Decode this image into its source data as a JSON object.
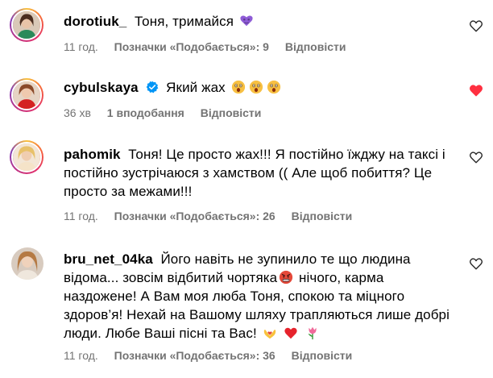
{
  "comments": [
    {
      "username": "dorotiuk_",
      "text": "Тоня, тримайся",
      "time": "11 год.",
      "likes": "Позначки «Подобається»: 9",
      "reply": "Відповісти"
    },
    {
      "username": "cybulskaya",
      "text": "Який жах",
      "time": "36 хв",
      "likes": "1 вподобання",
      "reply": "Відповісти"
    },
    {
      "username": "pahomik",
      "text": "Тоня! Це просто жах!!! Я постійно їжджу на таксі і постійно зустрічаюся з хамством (( Але щоб побиття? Це просто за межами!!!",
      "time": "11 год.",
      "likes": "Позначки «Подобається»: 26",
      "reply": "Відповісти"
    },
    {
      "username": "bru_net_04ka",
      "text_part1": "Його навіть не зупинило те що людина відома... зовсім відбитий чортяка",
      "text_part2": "нічого, карма наздожене! А Вам моя люба Тоня, спокою та міцного здоров’я! Нехай на Вашому шляху трапляються лише добрі люди. Любе Ваші пісні та Вас!",
      "time": "11 год.",
      "likes": "Позначки «Подобається»: 36",
      "reply": "Відповісти"
    }
  ],
  "colors": {
    "meta_gray": "#737373",
    "verified_blue": "#0095f6"
  },
  "icons": [
    "heart-outline-icon",
    "verified-badge-icon",
    "purple-heart-emoji",
    "shocked-face-emoji",
    "angry-face-emoji",
    "hands-heart-emoji",
    "red-heart-emoji",
    "tulip-emoji"
  ]
}
